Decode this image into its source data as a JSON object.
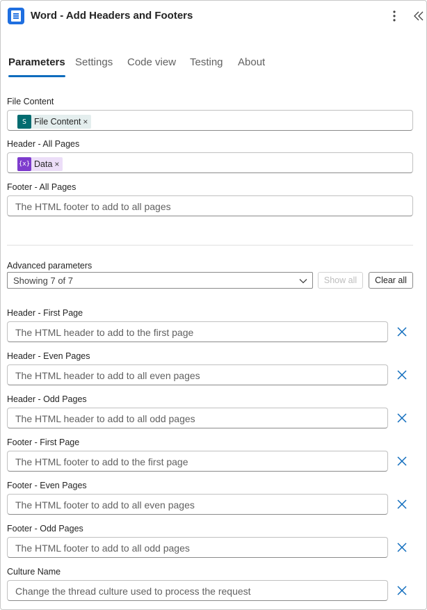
{
  "header": {
    "title": "Word - Add Headers and Footers",
    "more_icon": "more-vertical-icon",
    "collapse_icon": "chevron-double-left-icon"
  },
  "tabs": [
    {
      "label": "Parameters",
      "active": true
    },
    {
      "label": "Settings",
      "active": false
    },
    {
      "label": "Code view",
      "active": false
    },
    {
      "label": "Testing",
      "active": false
    },
    {
      "label": "About",
      "active": false
    }
  ],
  "params": {
    "file_content": {
      "label": "File Content",
      "token": {
        "label": "File Content",
        "icon": "sharepoint-icon",
        "icon_text": "S",
        "color": "#036c70",
        "bg": "#e4eeee"
      }
    },
    "header_all": {
      "label": "Header - All Pages",
      "token": {
        "label": "Data",
        "icon": "variable-icon",
        "icon_text": "{x}",
        "color": "#7e3ccd",
        "bg": "#ecdef8"
      }
    },
    "footer_all": {
      "label": "Footer - All Pages",
      "placeholder": "The HTML footer to add to all pages"
    }
  },
  "advanced": {
    "label": "Advanced parameters",
    "dropdown_value": "Showing 7 of 7",
    "show_all": "Show all",
    "clear_all": "Clear all",
    "fields": [
      {
        "label": "Header - First Page",
        "placeholder": "The HTML header to add to the first page"
      },
      {
        "label": "Header - Even Pages",
        "placeholder": "The HTML header to add to all even pages"
      },
      {
        "label": "Header - Odd Pages",
        "placeholder": "The HTML header to add to all odd pages"
      },
      {
        "label": "Footer - First Page",
        "placeholder": "The HTML footer to add to the first page"
      },
      {
        "label": "Footer - Even Pages",
        "placeholder": "The HTML footer to add to all even pages"
      },
      {
        "label": "Footer - Odd Pages",
        "placeholder": "The HTML footer to add to all odd pages"
      },
      {
        "label": "Culture Name",
        "placeholder": "Change the thread culture used to process the request"
      }
    ]
  },
  "colors": {
    "accent": "#0f6cbd",
    "remove_icon": "#0f6cbd"
  }
}
